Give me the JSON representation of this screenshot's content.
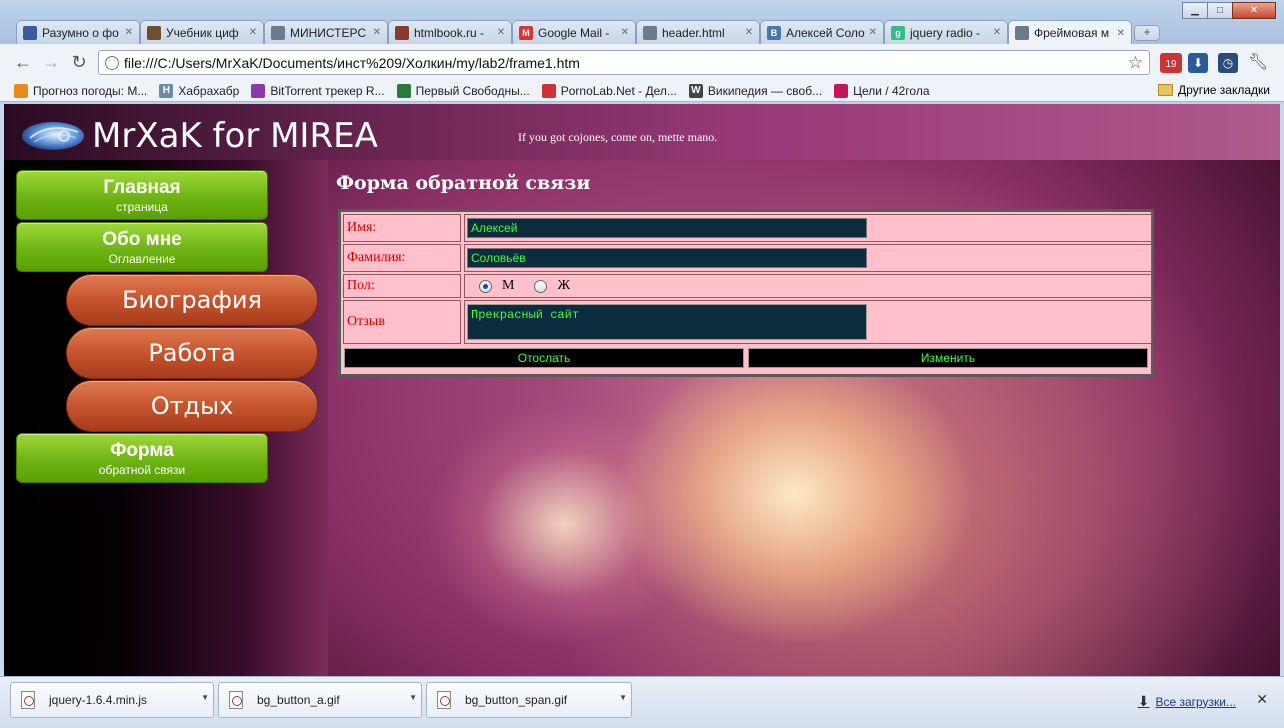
{
  "window": {
    "title": "",
    "buttons": {
      "minimize": "▁",
      "maximize": "□",
      "close": "✕"
    }
  },
  "tabs": [
    {
      "title": "Разумно о фо",
      "favicon_color": "#3a5aa0",
      "glyph": ""
    },
    {
      "title": "Учебник циф",
      "favicon_color": "#6b5030",
      "glyph": ""
    },
    {
      "title": "МИНИСТЕРС",
      "favicon_color": "#6a7a8a",
      "glyph": ""
    },
    {
      "title": "htmlbook.ru -",
      "favicon_color": "#8a3a2a",
      "glyph": ""
    },
    {
      "title": "Google Mail -",
      "favicon_color": "#d33",
      "glyph": "M"
    },
    {
      "title": "header.html",
      "favicon_color": "#6a7a8a",
      "glyph": ""
    },
    {
      "title": "Алексей Соло",
      "favicon_color": "#4a76a8",
      "glyph": "B"
    },
    {
      "title": "jquery radio -",
      "favicon_color": "#3b8",
      "glyph": "g"
    },
    {
      "title": "Фреймовая м",
      "favicon_color": "#6a7a8a",
      "glyph": ""
    }
  ],
  "toolbar": {
    "back": "←",
    "forward": "→",
    "reload": "↻",
    "url": "file:///C:/Users/MrXaK/Documents/инст%209/Холкин/my/lab2/frame1.htm",
    "star": "☆",
    "ext_badge": "19"
  },
  "bookmarks": [
    {
      "label": "Прогноз погоды: М...",
      "color": "#e88a1a",
      "glyph": ""
    },
    {
      "label": "Хабрахабр",
      "color": "#6a8aa8",
      "glyph": "H"
    },
    {
      "label": "BitTorrent трекер R...",
      "color": "#8a3aa8",
      "glyph": ""
    },
    {
      "label": "Первый Свободны...",
      "color": "#2a7a3a",
      "glyph": ""
    },
    {
      "label": "PornoLab.Net - Дел...",
      "color": "#c33",
      "glyph": ""
    },
    {
      "label": "Википедия — своб...",
      "color": "#444",
      "glyph": "W"
    },
    {
      "label": "Цели / 42гола",
      "color": "#c2185b",
      "glyph": ""
    }
  ],
  "other_bookmarks": "Другие закладки",
  "site": {
    "title": "MrXaK for MIREA",
    "slogan": "If you got cojones, come on, mette mano."
  },
  "nav": {
    "home": {
      "main": "Главная",
      "sub": "страница"
    },
    "about": {
      "main": "Обо мне",
      "sub": "Оглавление"
    },
    "bio": "Биография",
    "work": "Работа",
    "rest": "Отдых",
    "form": {
      "main": "Форма",
      "sub": "обратной связи"
    }
  },
  "form": {
    "heading": "Форма обратной связи",
    "name_label": "Имя:",
    "name_value": "Алексей",
    "surname_label": "Фамилия:",
    "surname_value": "Соловьёв",
    "gender_label": "Пол:",
    "gender_m": "М",
    "gender_f": "Ж",
    "gender_selected": "М",
    "review_label": "Отзыв",
    "review_value": "Прекрасный сайт",
    "submit": "Отослать",
    "reset": "Изменить"
  },
  "downloads": {
    "items": [
      "jquery-1.6.4.min.js",
      "bg_button_a.gif",
      "bg_button_span.gif"
    ],
    "all": "Все загрузки...",
    "close": "✕"
  }
}
